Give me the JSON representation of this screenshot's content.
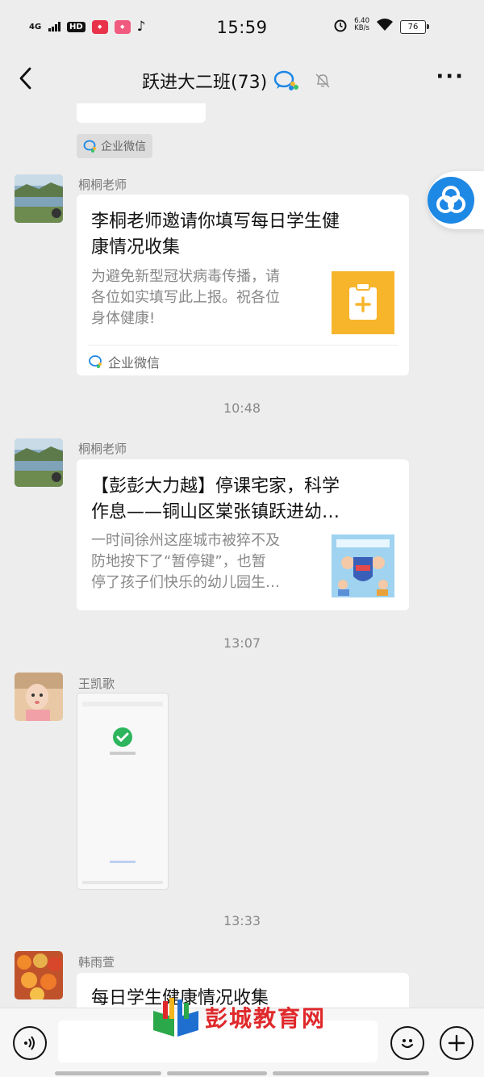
{
  "status_bar": {
    "network": "4G",
    "hd": "HD",
    "time": "15:59",
    "speed_value": "6.40",
    "speed_unit": "KB/s",
    "battery": "76",
    "icons": [
      "alarm-icon",
      "wifi-icon",
      "tiktok-icon"
    ]
  },
  "nav": {
    "title": "跃进大二班(73)"
  },
  "messages": {
    "top_partial_label": "企业微信",
    "msg1": {
      "sender": "桐桐老师",
      "title_line1": "李桐老师邀请你填写每日学生健",
      "title_line2": "康情况收集",
      "desc_line1": "为避免新型冠状病毒传播，请",
      "desc_line2": "各位如实填写此上报。祝各位",
      "desc_line3": "身体健康!",
      "source": "企业微信"
    },
    "time1": "10:48",
    "msg2": {
      "sender": "桐桐老师",
      "title_line1": "【彭彭大力越】停课宅家，科学",
      "title_line2": "作息——铜山区棠张镇跃进幼…",
      "desc_line1": "一时间徐州这座城市被猝不及",
      "desc_line2": "防地按下了“暂停键”，也暂",
      "desc_line3": "停了孩子们快乐的幼儿园生…"
    },
    "time2": "13:07",
    "msg3": {
      "sender": "王凯歌"
    },
    "time3": "13:33",
    "msg4": {
      "sender": "韩雨萱",
      "title_line1": "每日学生健康情况收集"
    }
  },
  "watermark": {
    "text": "彭城教育网"
  },
  "colors": {
    "background": "#ededed",
    "card": "#ffffff",
    "form_icon": "#f7b52c",
    "floating_icon": "#1e88e5",
    "watermark": "#e0282b"
  }
}
